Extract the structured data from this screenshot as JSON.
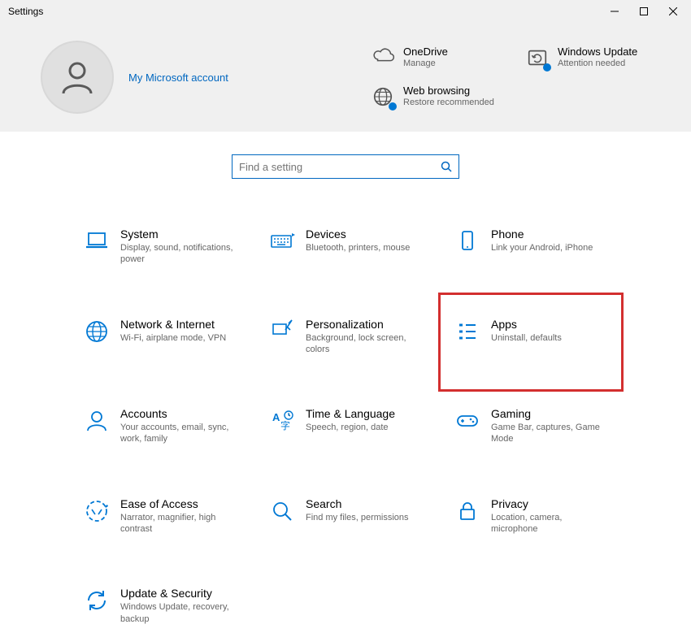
{
  "window": {
    "title": "Settings"
  },
  "header": {
    "account_link": "My Microsoft account",
    "status": [
      {
        "id": "onedrive",
        "title": "OneDrive",
        "sub": "Manage",
        "icon": "cloud-icon",
        "dot": false
      },
      {
        "id": "windows-update",
        "title": "Windows Update",
        "sub": "Attention needed",
        "icon": "update-sync-icon",
        "dot": true
      },
      {
        "id": "web-browsing",
        "title": "Web browsing",
        "sub": "Restore recommended",
        "icon": "globe-icon",
        "dot": true
      }
    ]
  },
  "search": {
    "placeholder": "Find a setting"
  },
  "categories": [
    {
      "id": "system",
      "title": "System",
      "sub": "Display, sound, notifications, power",
      "icon": "laptop-icon",
      "highlighted": false
    },
    {
      "id": "devices",
      "title": "Devices",
      "sub": "Bluetooth, printers, mouse",
      "icon": "keyboard-icon",
      "highlighted": false
    },
    {
      "id": "phone",
      "title": "Phone",
      "sub": "Link your Android, iPhone",
      "icon": "phone-icon",
      "highlighted": false
    },
    {
      "id": "network",
      "title": "Network & Internet",
      "sub": "Wi-Fi, airplane mode, VPN",
      "icon": "globe-net-icon",
      "highlighted": false
    },
    {
      "id": "personalization",
      "title": "Personalization",
      "sub": "Background, lock screen, colors",
      "icon": "paintbrush-icon",
      "highlighted": false
    },
    {
      "id": "apps",
      "title": "Apps",
      "sub": "Uninstall, defaults",
      "icon": "apps-list-icon",
      "highlighted": true
    },
    {
      "id": "accounts",
      "title": "Accounts",
      "sub": "Your accounts, email, sync, work, family",
      "icon": "person-icon",
      "highlighted": false
    },
    {
      "id": "time-language",
      "title": "Time & Language",
      "sub": "Speech, region, date",
      "icon": "time-lang-icon",
      "highlighted": false
    },
    {
      "id": "gaming",
      "title": "Gaming",
      "sub": "Game Bar, captures, Game Mode",
      "icon": "gamepad-icon",
      "highlighted": false
    },
    {
      "id": "ease-of-access",
      "title": "Ease of Access",
      "sub": "Narrator, magnifier, high contrast",
      "icon": "ease-icon",
      "highlighted": false
    },
    {
      "id": "search-cat",
      "title": "Search",
      "sub": "Find my files, permissions",
      "icon": "search-icon",
      "highlighted": false
    },
    {
      "id": "privacy",
      "title": "Privacy",
      "sub": "Location, camera, microphone",
      "icon": "lock-icon",
      "highlighted": false
    },
    {
      "id": "update-security",
      "title": "Update & Security",
      "sub": "Windows Update, recovery, backup",
      "icon": "sync-icon",
      "highlighted": false
    }
  ],
  "colors": {
    "accent": "#0067c0",
    "highlight": "#d32f2f"
  }
}
